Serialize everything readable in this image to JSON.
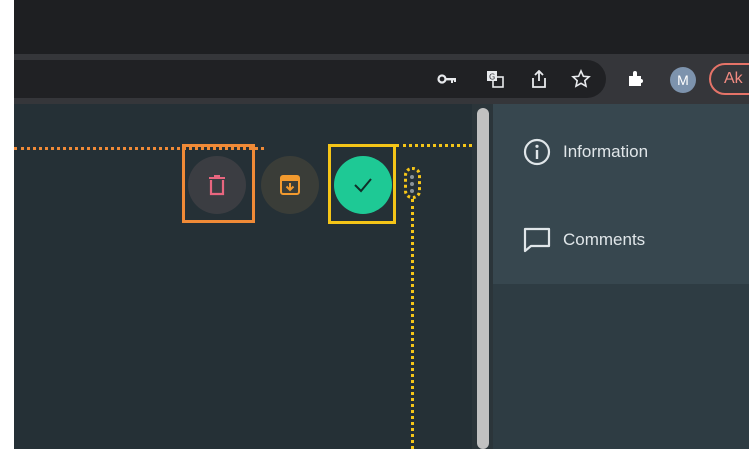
{
  "browser": {
    "profile_initial": "M",
    "profile_button_label": "Ak",
    "toolbar_icons": [
      "key-icon",
      "translate-icon",
      "share-icon",
      "star-icon",
      "extensions-icon"
    ]
  },
  "action_bar": {
    "buttons": [
      {
        "name": "delete-button",
        "icon": "trash-icon",
        "color": "#e8667f"
      },
      {
        "name": "archive-button",
        "icon": "archive-icon",
        "color": "#f29a2e"
      },
      {
        "name": "approve-button",
        "icon": "check-icon",
        "color": "#1ec995"
      }
    ]
  },
  "side_panel": {
    "items": [
      {
        "label": "Information",
        "icon": "info-icon"
      },
      {
        "label": "Comments",
        "icon": "comment-icon"
      }
    ]
  },
  "annotation_colors": {
    "orange": "#f08a37",
    "yellow": "#f5c518"
  }
}
